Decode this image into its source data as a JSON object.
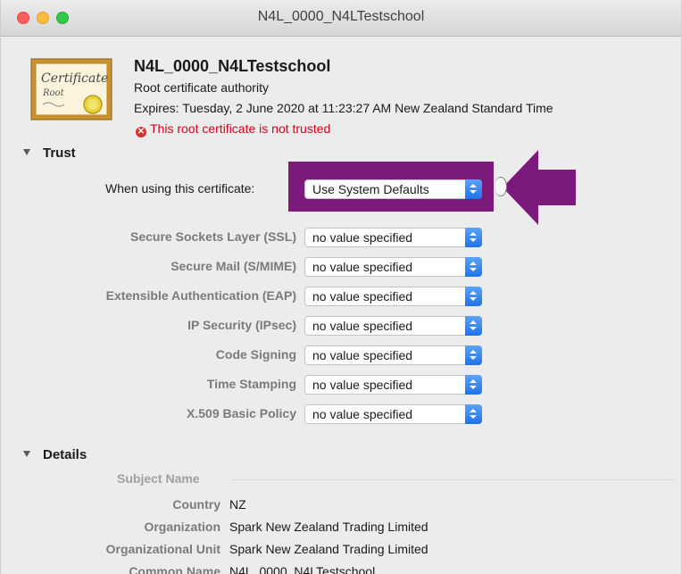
{
  "window": {
    "title": "N4L_0000_N4LTestschool"
  },
  "certificate": {
    "icon_name": "certificate-icon",
    "icon_text_1": "Certificate",
    "icon_text_2": "Root",
    "name": "N4L_0000_N4LTestschool",
    "type": "Root certificate authority",
    "expires": "Expires: Tuesday, 2 June 2020 at 11:23:27 AM New Zealand Standard Time",
    "warning_icon": "x-circle-icon",
    "warning": "This root certificate is not trusted"
  },
  "trust": {
    "heading": "Trust",
    "when_using_label": "When using this certificate:",
    "when_using_value": "Use System Defaults",
    "rows": [
      {
        "label": "Secure Sockets Layer (SSL)",
        "value": "no value specified"
      },
      {
        "label": "Secure Mail (S/MIME)",
        "value": "no value specified"
      },
      {
        "label": "Extensible Authentication (EAP)",
        "value": "no value specified"
      },
      {
        "label": "IP Security (IPsec)",
        "value": "no value specified"
      },
      {
        "label": "Code Signing",
        "value": "no value specified"
      },
      {
        "label": "Time Stamping",
        "value": "no value specified"
      },
      {
        "label": "X.509 Basic Policy",
        "value": "no value specified"
      }
    ]
  },
  "details": {
    "heading": "Details",
    "subject_name": "Subject Name",
    "fields": [
      {
        "label": "Country",
        "value": "NZ"
      },
      {
        "label": "Organization",
        "value": "Spark New Zealand Trading Limited"
      },
      {
        "label": "Organizational Unit",
        "value": "Spark New Zealand Trading Limited"
      },
      {
        "label": "Common Name",
        "value": "N4L_0000_N4LTestschool"
      }
    ]
  },
  "annotation": {
    "color": "#7c1a7c"
  }
}
